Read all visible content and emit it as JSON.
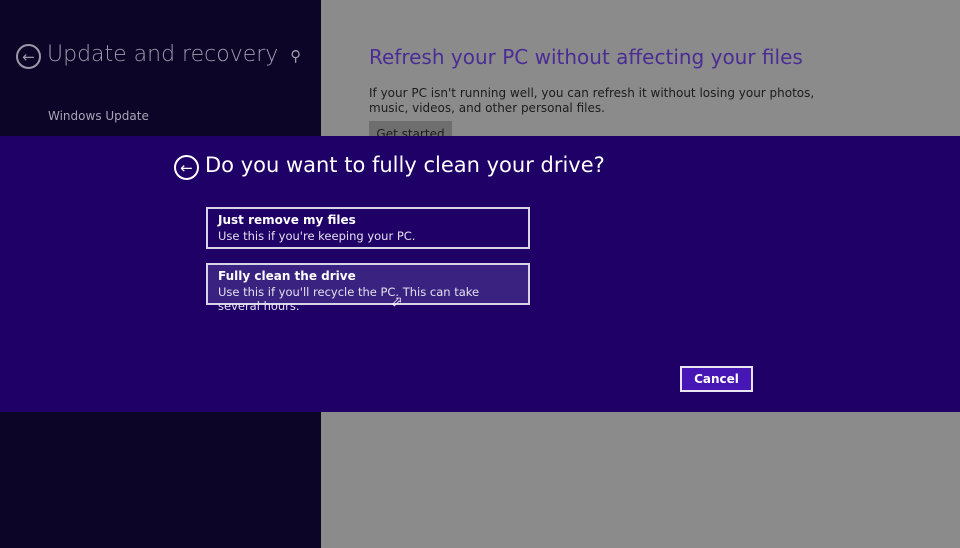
{
  "sidebar": {
    "title": "Update and recovery",
    "items": [
      {
        "label": "Windows Update"
      }
    ],
    "back_icon": "back-arrow-circle-icon",
    "search_icon": "search-icon"
  },
  "main": {
    "title": "Refresh your PC without affecting your files",
    "description": "If your PC isn't running well, you can refresh it without losing your photos, music, videos, and other personal files.",
    "button_label": "Get started"
  },
  "dialog": {
    "title": "Do you want to fully clean your drive?",
    "options": [
      {
        "title": "Just remove my files",
        "description": "Use this if you're keeping your PC."
      },
      {
        "title": "Fully clean the drive",
        "description": "Use this if you'll recycle the PC. This can take several hours."
      }
    ],
    "cancel_label": "Cancel",
    "colors": {
      "background": "#1e0066",
      "accent": "#4617b4"
    }
  }
}
